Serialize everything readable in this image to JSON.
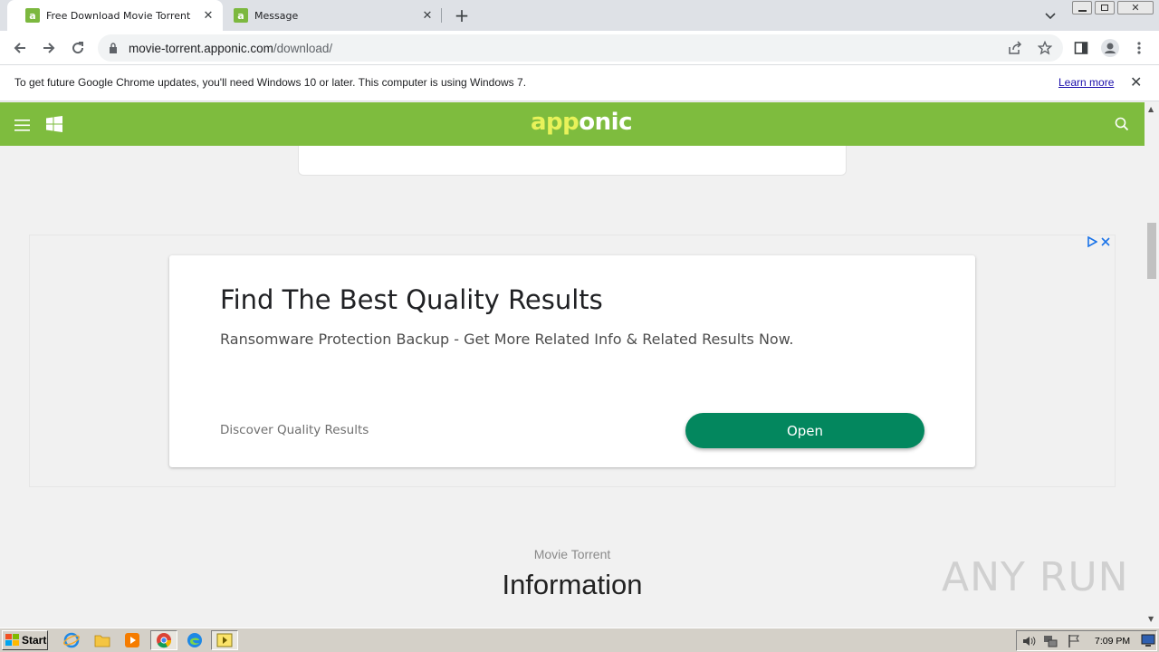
{
  "browser": {
    "tabs": [
      {
        "title": "Free Download Movie Torrent",
        "favicon": "a",
        "active": true
      },
      {
        "title": "Message",
        "favicon": "a",
        "active": false
      }
    ],
    "url_host": "movie-torrent.apponic.com",
    "url_path": "/download/"
  },
  "infobar": {
    "message": "To get future Google Chrome updates, you'll need Windows 10 or later. This computer is using Windows 7.",
    "learn_more": "Learn more"
  },
  "site": {
    "logo_part1": "app",
    "logo_part2": "onic",
    "accent_color": "#7ebc3e"
  },
  "ad": {
    "title": "Find The Best Quality Results",
    "description": "Ransomware Protection Backup - Get More Related Info & Related Results Now.",
    "footer": "Discover Quality Results",
    "button": "Open",
    "button_color": "#03875e"
  },
  "section": {
    "subtitle": "Movie Torrent",
    "title": "Information"
  },
  "watermark": "ANY RUN",
  "taskbar": {
    "start_label": "Start",
    "clock": "7:09 PM"
  }
}
